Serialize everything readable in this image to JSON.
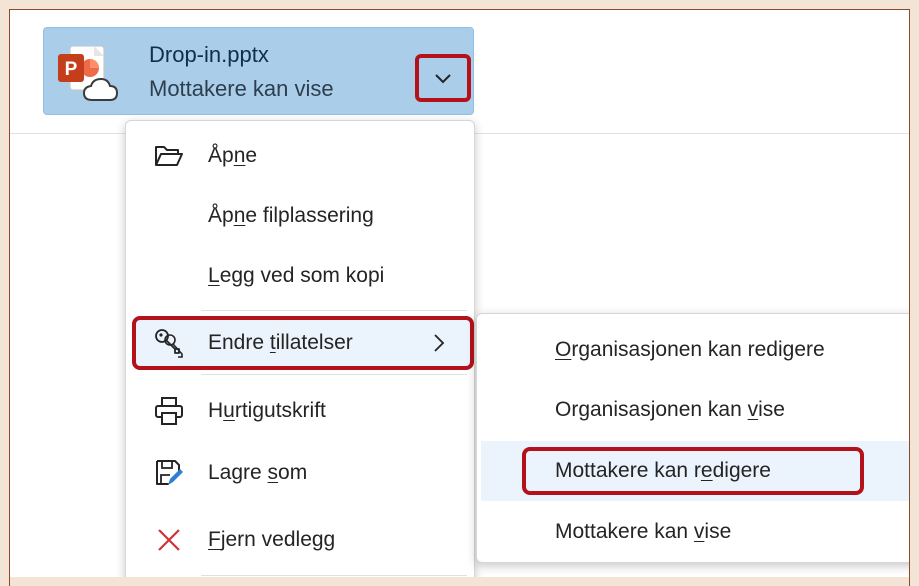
{
  "attachment": {
    "file_name": "Drop-in.pptx",
    "status": "Mottakere kan vise",
    "icon": "powerpoint-cloud-icon",
    "dropdown_icon": "chevron-down-icon"
  },
  "menu": {
    "items": [
      {
        "pre": "Åp",
        "key": "n",
        "post": "e",
        "icon": "folder-open-icon"
      },
      {
        "pre": "Åp",
        "key": "n",
        "post": "e filplassering",
        "icon": ""
      },
      {
        "pre": "",
        "key": "L",
        "post": "egg ved som kopi",
        "icon": ""
      },
      {
        "pre": "Endre ",
        "key": "t",
        "post": "illatelser",
        "icon": "key-multiple-icon",
        "has_submenu": true,
        "highlighted": true
      },
      {
        "pre": "H",
        "key": "u",
        "post": "rtigutskrift",
        "icon": "print-icon"
      },
      {
        "pre": "Lagre ",
        "key": "s",
        "post": "om",
        "icon": "save-edit-icon"
      },
      {
        "pre": "",
        "key": "F",
        "post": "jern vedlegg",
        "icon": "dismiss-icon"
      }
    ]
  },
  "submenu": {
    "items": [
      {
        "pre": "",
        "key": "O",
        "post": "rganisasjonen kan redigere"
      },
      {
        "pre": "Organisasjonen kan ",
        "key": "v",
        "post": "ise"
      },
      {
        "pre": "Mottakere kan r",
        "key": "e",
        "post": "digere",
        "highlighted": true
      },
      {
        "pre": "Mottakere kan ",
        "key": "v",
        "post": "ise"
      }
    ]
  },
  "colors": {
    "chip_bg": "#aacde9",
    "highlight_border": "#b3121a",
    "hover_bg": "#ebf3fc",
    "ppt_orange": "#c43e1c",
    "dismiss_red": "#d13438"
  }
}
